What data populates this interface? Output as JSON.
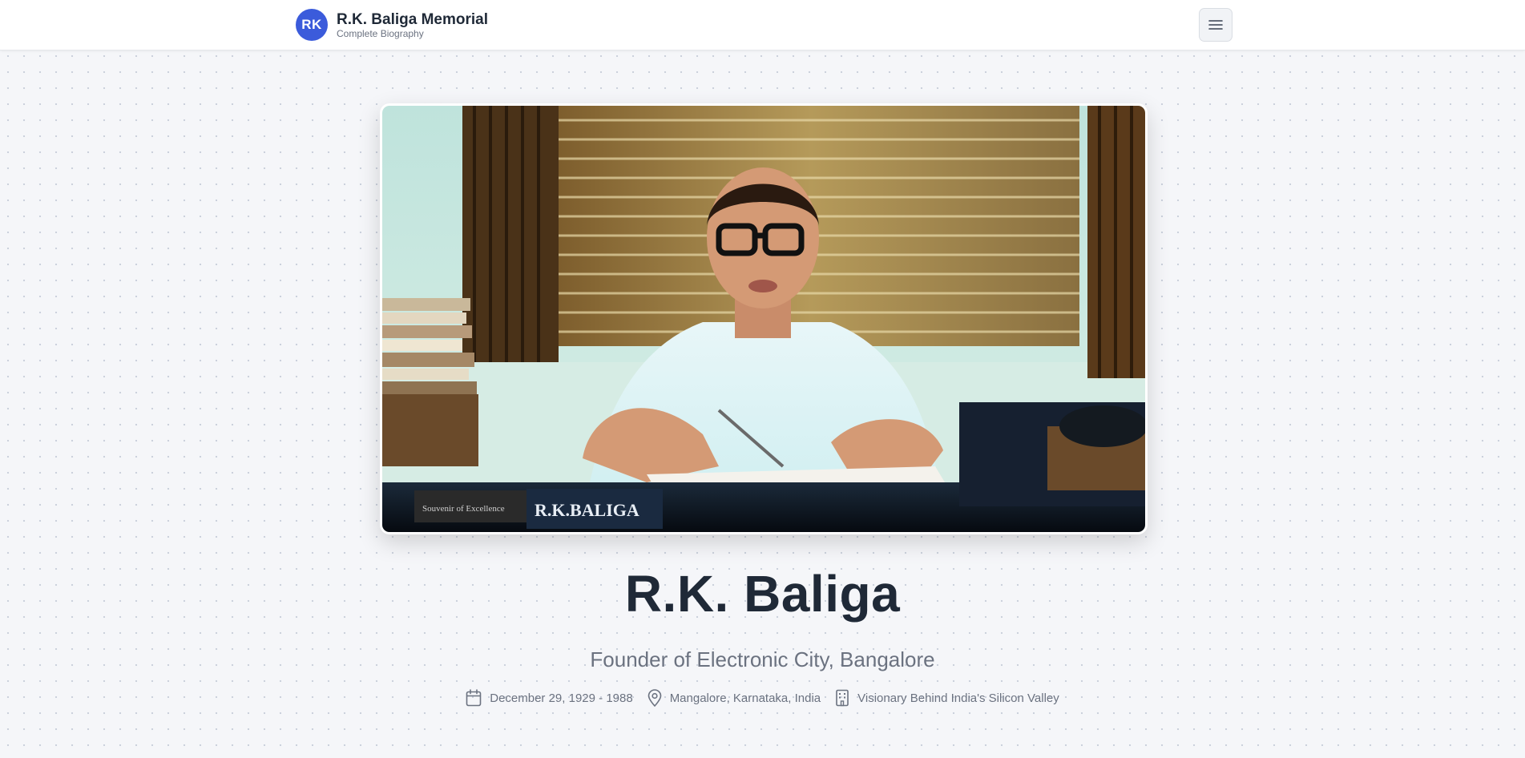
{
  "header": {
    "logo_initials": "RK",
    "title": "R.K. Baliga Memorial",
    "subtitle": "Complete Biography",
    "menu_icon": "hamburger-menu-icon"
  },
  "hero": {
    "photo_caption": "R.K.BALIGA",
    "photo_plate_text": "Souvenir of Excellence"
  },
  "profile": {
    "name": "R.K. Baliga",
    "tagline": "Founder of Electronic City, Bangalore",
    "meta": [
      {
        "icon": "calendar-icon",
        "text": "December 29, 1929 - 1988"
      },
      {
        "icon": "map-pin-icon",
        "text": "Mangalore, Karnataka, India"
      },
      {
        "icon": "building-icon",
        "text": "Visionary Behind India's Silicon Valley"
      }
    ]
  },
  "colors": {
    "accent": "#3b5bdb",
    "text_primary": "#1f2937",
    "text_muted": "#6b7280"
  }
}
